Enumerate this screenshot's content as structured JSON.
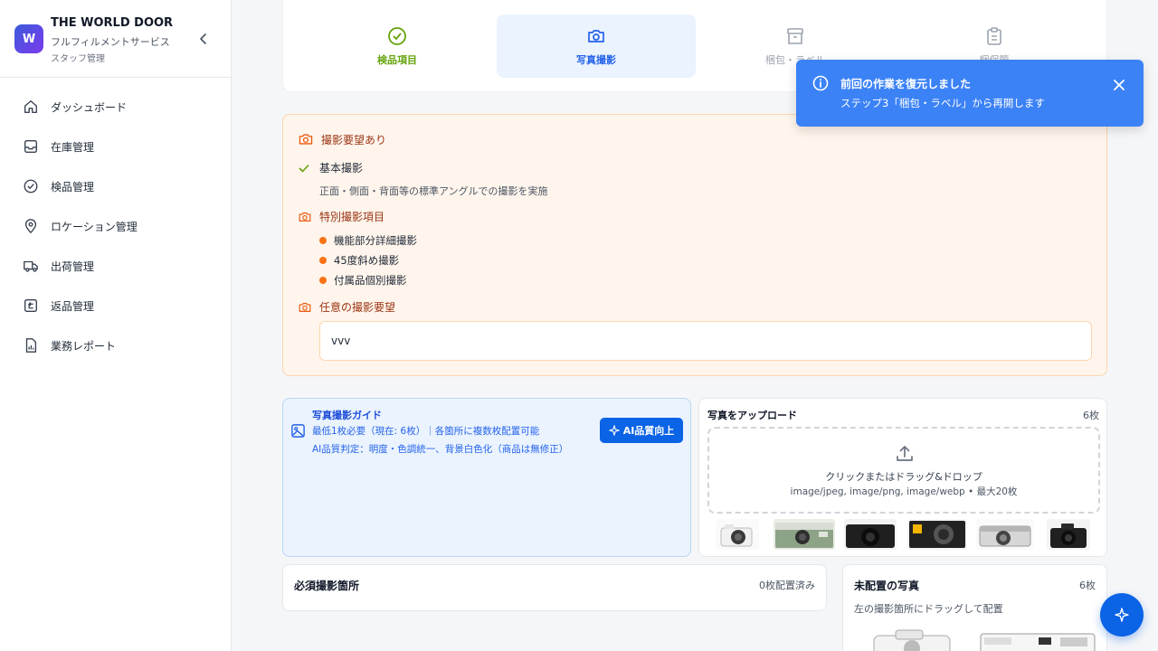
{
  "brand": {
    "logo_letter": "W",
    "title": "THE WORLD DOOR",
    "subtitle": "フルフィルメントサービス",
    "role": "スタッフ管理"
  },
  "sidebar": {
    "items": [
      {
        "label": "ダッシュボード",
        "icon": "home-icon"
      },
      {
        "label": "在庫管理",
        "icon": "inbox-icon"
      },
      {
        "label": "検品管理",
        "icon": "check-circle-icon"
      },
      {
        "label": "ロケーション管理",
        "icon": "map-pin-icon"
      },
      {
        "label": "出荷管理",
        "icon": "truck-icon"
      },
      {
        "label": "返品管理",
        "icon": "return-icon"
      },
      {
        "label": "業務レポート",
        "icon": "report-icon"
      }
    ]
  },
  "steps": [
    {
      "label": "検品項目",
      "state": "done",
      "icon": "check-circle-icon"
    },
    {
      "label": "写真撮影",
      "state": "active",
      "icon": "camera-icon"
    },
    {
      "label": "梱包・ラベル",
      "state": "todo",
      "icon": "box-icon"
    },
    {
      "label": "梱保簡",
      "state": "todo",
      "icon": "clipboard-icon"
    }
  ],
  "requirements": {
    "heading": "撮影要望あり",
    "basic_title": "基本撮影",
    "basic_desc": "正面・側面・背面等の標準アングルでの撮影を実施",
    "special_title": "特別撮影項目",
    "special_items": [
      "機能部分詳細撮影",
      "45度斜め撮影",
      "付属品個別撮影"
    ],
    "optional_title": "任意の撮影要望",
    "optional_value": "vvv"
  },
  "guide": {
    "title": "写真撮影ガイド",
    "line1": "最低1枚必要（現在: 6枚）｜各箇所に複数枚配置可能",
    "line2": "AI品質判定：明度・色調統一、背景白色化（商品は無修正）",
    "ai_button": "AI品質向上"
  },
  "upload": {
    "title": "写真をアップロード",
    "count": "6枚",
    "drop_text": "クリックまたはドラッグ&ドロップ",
    "formats": "image/jpeg, image/png, image/webp • 最大20枚",
    "thumbnails": [
      "white-mirrorless-camera",
      "green-film-camera",
      "black-dslr-camera",
      "kodak-compact-camera",
      "silver-film-camera",
      "black-mirrorless-camera"
    ]
  },
  "required_spots": {
    "title": "必須撮影箇所",
    "count": "0枚配置済み"
  },
  "unplaced": {
    "title": "未配置の写真",
    "count": "6枚",
    "hint": "左の撮影箇所にドラッグして配置"
  },
  "toast": {
    "title": "前回の作業を復元しました",
    "message": "ステップ3「梱包・ラベル」から再開します"
  },
  "colors": {
    "primary": "#0b63e5",
    "toast": "#3b82f6",
    "done_green": "#65a30d",
    "warning_orange": "#f97316",
    "req_bg": "#fff5ec"
  }
}
